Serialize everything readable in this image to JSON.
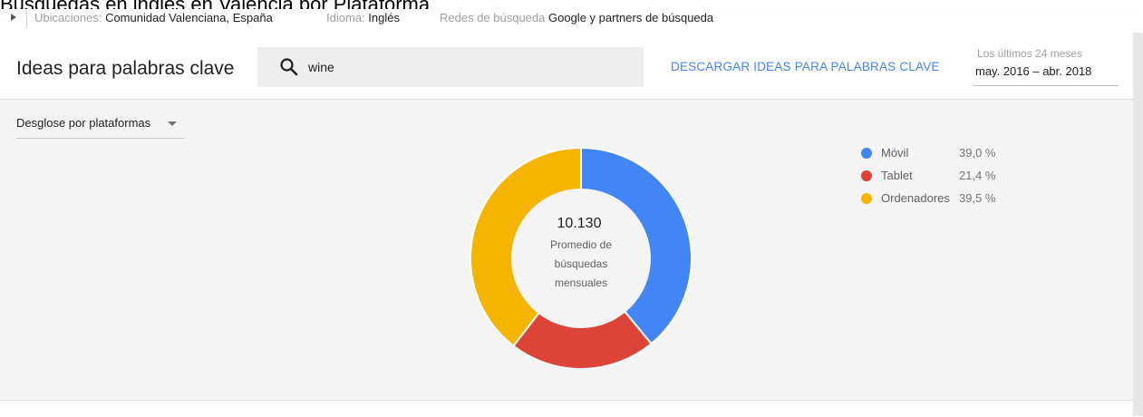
{
  "caption": "Búsquedas en inglés en Valencia por Plataforma",
  "filters": {
    "locations_label": "Ubicaciones:",
    "locations_value": "Comunidad Valenciana, España",
    "language_label": "Idioma:",
    "language_value": "Inglés",
    "networks_label": "Redes de búsqueda",
    "networks_value": "Google y partners de búsqueda"
  },
  "header": {
    "title": "Ideas para palabras clave",
    "search_value": "wine",
    "search_icon": "search-icon",
    "download_label": "DESCARGAR IDEAS PARA PALABRAS CLAVE",
    "date_label": "Los últimos 24 meses",
    "date_value": "may. 2016 – abr. 2018"
  },
  "panel": {
    "breakdown_label": "Desglose por plataformas"
  },
  "center": {
    "value": "10.130",
    "line1": "Promedio de",
    "line2": "búsquedas",
    "line3": "mensuales"
  },
  "legend": [
    {
      "name": "Móvil",
      "pct": "39,0 %",
      "color": "#4285f4"
    },
    {
      "name": "Tablet",
      "pct": "21,4 %",
      "color": "#db4437"
    },
    {
      "name": "Ordenadores",
      "pct": "39,5 %",
      "color": "#f4b400"
    }
  ],
  "chart_data": {
    "type": "pie",
    "categories": [
      "Móvil",
      "Tablet",
      "Ordenadores"
    ],
    "values": [
      39.0,
      21.4,
      39.5
    ],
    "colors": [
      "#4285f4",
      "#db4437",
      "#f4b400"
    ],
    "legend_position": "right"
  }
}
